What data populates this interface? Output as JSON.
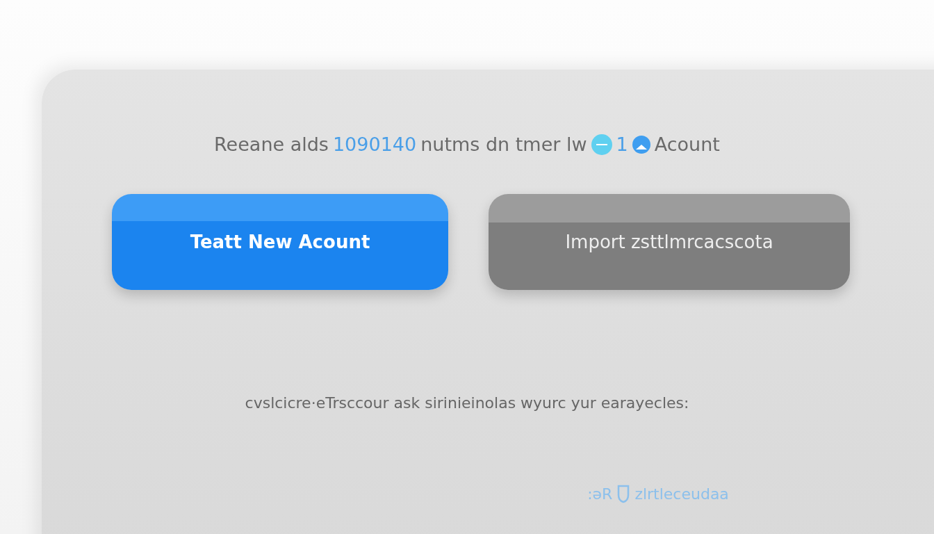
{
  "heading": {
    "parts": [
      {
        "kind": "text",
        "text": "Reeane alds"
      },
      {
        "kind": "accent",
        "text": "1090140"
      },
      {
        "kind": "text",
        "text": "nutms dn tmer lw"
      },
      {
        "kind": "badge"
      },
      {
        "kind": "accent",
        "text": "1"
      },
      {
        "kind": "avatar"
      },
      {
        "kind": "text",
        "text": "Acount"
      }
    ]
  },
  "buttons": [
    {
      "label": "Teatt New Acount",
      "kind": "primary"
    },
    {
      "label": "Import zsttlmrcacscota",
      "kind": "secondary"
    }
  ],
  "subtitle": "cvslcicre·eTrsccour ask sirinieinolas wyurc yur earayecles:",
  "footer_link": {
    "prefix": ":əR",
    "text": "zlrtleceudaa"
  }
}
